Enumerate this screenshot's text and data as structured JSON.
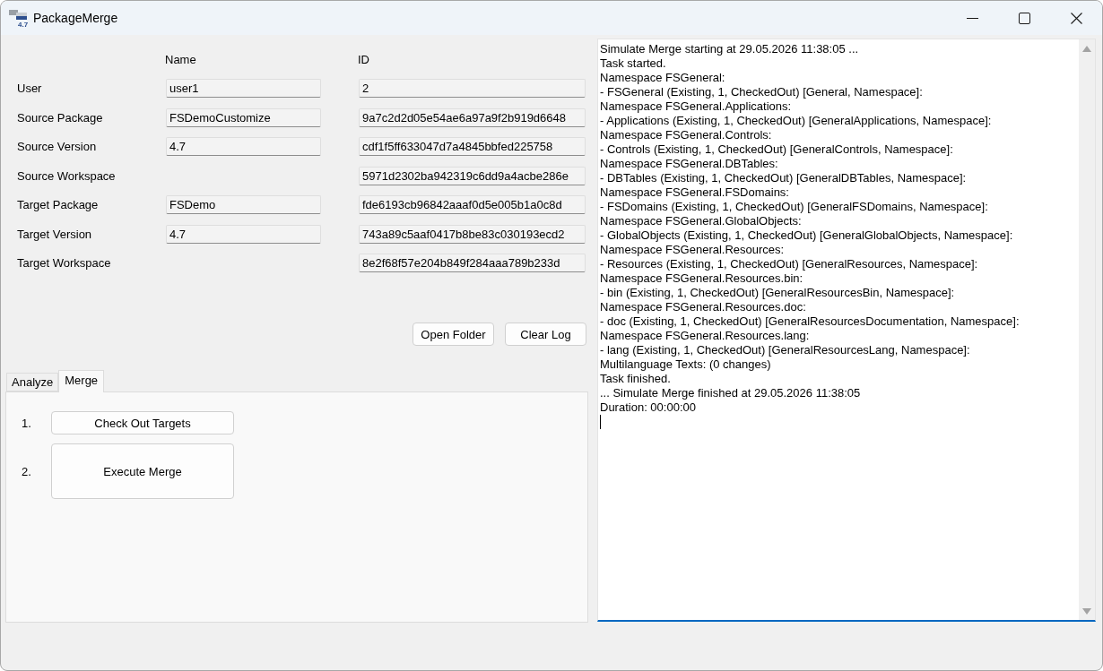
{
  "window": {
    "title": "PackageMerge",
    "icon_label": "4.7"
  },
  "form": {
    "columns": [
      "Name",
      "ID"
    ],
    "rows": [
      {
        "label": "User",
        "name": "user1",
        "id": "2"
      },
      {
        "label": "Source Package",
        "name": "FSDemoCustomize",
        "id": "9a7c2d2d05e54ae6a97a9f2b919d6648"
      },
      {
        "label": "Source Version",
        "name": "4.7",
        "id": "cdf1f5ff633047d7a4845bbfed225758"
      },
      {
        "label": "Source Workspace",
        "id": "5971d2302ba942319c6dd9a4acbe286e"
      },
      {
        "label": "Target Package",
        "name": "FSDemo",
        "id": "fde6193cb96842aaaf0d5e005b1a0c8d"
      },
      {
        "label": "Target Version",
        "name": "4.7",
        "id": "743a89c5aaf0417b8be83c030193ecd2"
      },
      {
        "label": "Target Workspace",
        "id": "8e2f68f57e204b849f284aaa789b233d"
      }
    ]
  },
  "buttons": [
    "Open Folder",
    "Clear Log"
  ],
  "tabs": [
    {
      "label": "Analyze",
      "selected": false
    },
    {
      "label": "Merge",
      "selected": true
    }
  ],
  "steps": [
    {
      "number": "1.",
      "label": "Check Out Targets",
      "kind": "compact"
    },
    {
      "number": "2.",
      "label": "Execute Merge",
      "kind": "large"
    }
  ],
  "log": {
    "focused": true,
    "lines": [
      "Simulate Merge starting at 29.05.2026 11:38:05 ...",
      "Task started.",
      "Namespace FSGeneral:",
      "- FSGeneral (Existing, 1, CheckedOut) [General, Namespace]:",
      "Namespace FSGeneral.Applications:",
      "- Applications (Existing, 1, CheckedOut) [GeneralApplications, Namespace]:",
      "Namespace FSGeneral.Controls:",
      "- Controls (Existing, 1, CheckedOut) [GeneralControls, Namespace]:",
      "Namespace FSGeneral.DBTables:",
      "- DBTables (Existing, 1, CheckedOut) [GeneralDBTables, Namespace]:",
      "Namespace FSGeneral.FSDomains:",
      "- FSDomains (Existing, 1, CheckedOut) [GeneralFSDomains, Namespace]:",
      "Namespace FSGeneral.GlobalObjects:",
      "- GlobalObjects (Existing, 1, CheckedOut) [GeneralGlobalObjects, Namespace]:",
      "Namespace FSGeneral.Resources:",
      "- Resources (Existing, 1, CheckedOut) [GeneralResources, Namespace]:",
      "Namespace FSGeneral.Resources.bin:",
      "- bin (Existing, 1, CheckedOut) [GeneralResourcesBin, Namespace]:",
      "Namespace FSGeneral.Resources.doc:",
      "- doc (Existing, 1, CheckedOut) [GeneralResourcesDocumentation, Namespace]:",
      "Namespace FSGeneral.Resources.lang:",
      "- lang (Existing, 1, CheckedOut) [GeneralResourcesLang, Namespace]:",
      "Multilanguage Texts: (0 changes)",
      "Task finished.",
      "... Simulate Merge finished at 29.05.2026 11:38:05",
      "Duration: 00:00:00"
    ]
  }
}
